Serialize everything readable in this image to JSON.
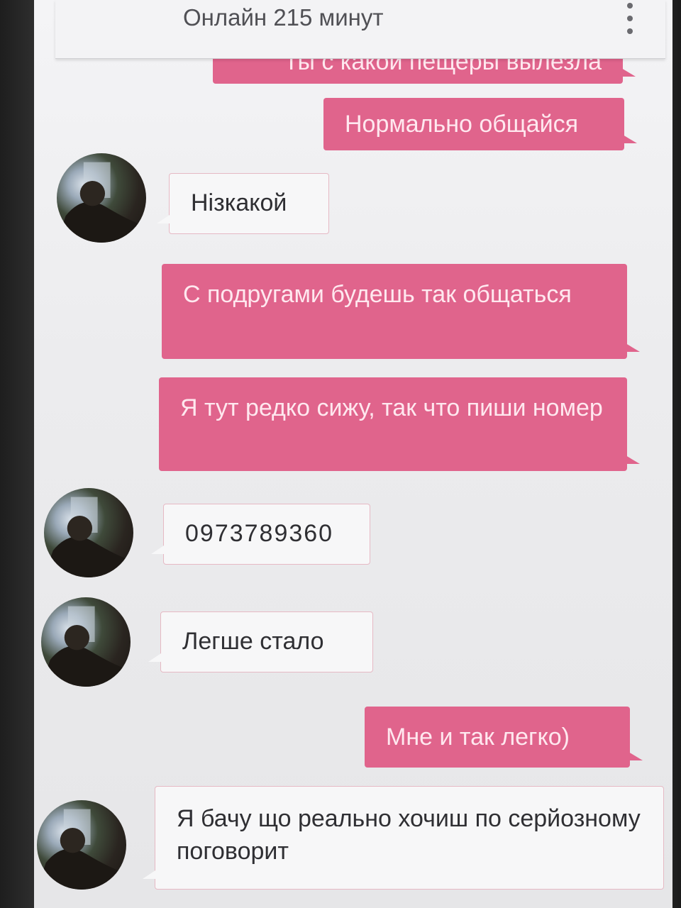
{
  "header": {
    "status": "Онлайн 215 минут"
  },
  "messages": [
    {
      "from": "me",
      "text": "Ты с какой пещеры вылезла"
    },
    {
      "from": "me",
      "text": "Нормально общайся"
    },
    {
      "from": "them",
      "text": "Нізкакой"
    },
    {
      "from": "me",
      "text": "С подругами будешь так общаться"
    },
    {
      "from": "me",
      "text": "Я тут редко сижу, так что пиши номер"
    },
    {
      "from": "them",
      "text": "0973789360"
    },
    {
      "from": "them",
      "text": "Легше стало"
    },
    {
      "from": "me",
      "text": "Мне и так легко)"
    },
    {
      "from": "them",
      "text": "Я бачу що реально хочиш по серйозному поговорит"
    }
  ],
  "colors": {
    "outgoing_bubble": "#e0648c",
    "incoming_bubble": "#f7f7f8",
    "background": "#ececee"
  },
  "icons": {
    "menu": "overflow-menu-icon",
    "avatar": "user-avatar"
  }
}
